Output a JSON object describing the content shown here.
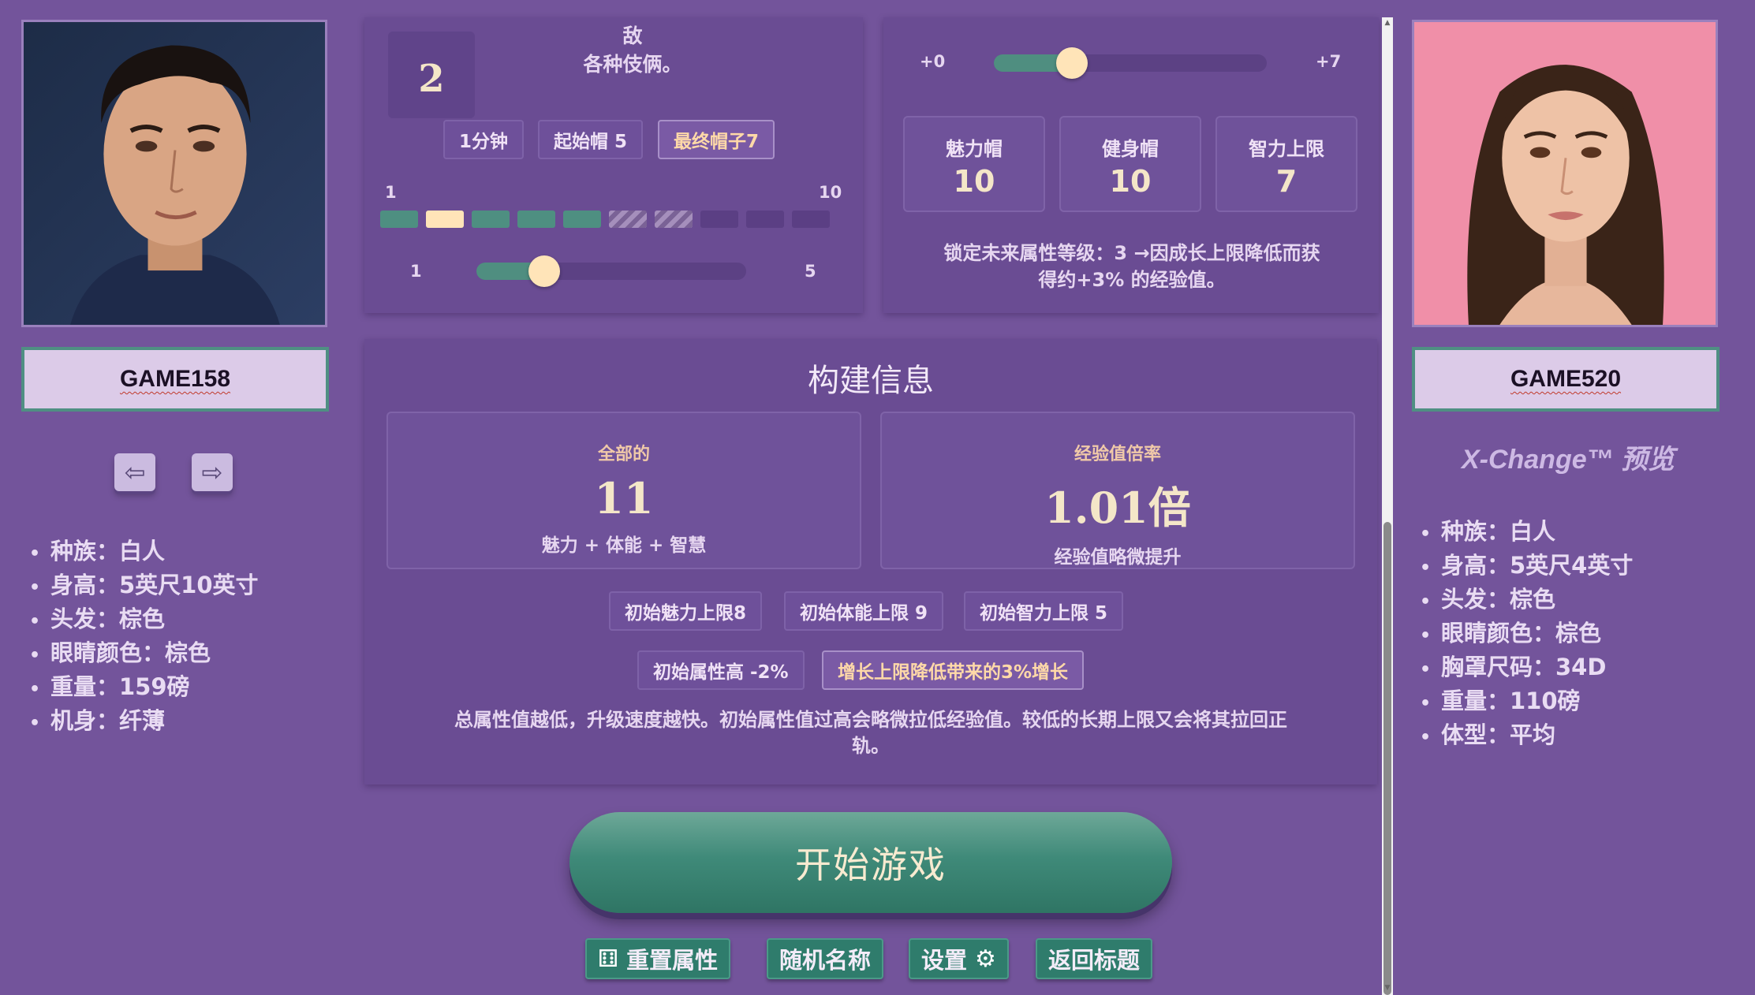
{
  "left_profile": {
    "username": "GAME158",
    "traits": [
      "种族：白人",
      "身高：5英尺10英寸",
      "头发：棕色",
      "眼睛颜色：棕色",
      "重量：159磅",
      "机身：纤薄"
    ]
  },
  "right_profile": {
    "username": "GAME520",
    "preview_title": "X-Change™ 预览",
    "traits": [
      "种族：白人",
      "身高：5英尺4英寸",
      "头发：棕色",
      "眼睛颜色：棕色",
      "胸罩尺码：34D",
      "重量：110磅",
      "体型：平均"
    ]
  },
  "panel_a": {
    "big_number": "2",
    "cut_text_line1": "提升你的就业前景，并帮助你职敌",
    "cut_text_line2": "各种伎俩。",
    "chips": [
      "1分钟",
      "起始帽 5",
      "最终帽子7"
    ],
    "active_chip": "最终帽子7",
    "range_min": "1",
    "range_max": "10",
    "segments": [
      "teal",
      "cream",
      "teal",
      "teal",
      "teal",
      "hatch",
      "hatch",
      "dark",
      "dark",
      "dark"
    ],
    "slider": {
      "min_label": "1",
      "max_label": "5",
      "value": 2,
      "min": 1,
      "max": 5
    }
  },
  "panel_b": {
    "slider": {
      "min_label": "+0",
      "max_label": "+7",
      "value": 2,
      "min": 0,
      "max": 7
    },
    "stats": [
      {
        "label": "魅力帽",
        "value": "10"
      },
      {
        "label": "健身帽",
        "value": "10"
      },
      {
        "label": "智力上限",
        "value": "7"
      }
    ],
    "lock_note_line1": "锁定未来属性等级：3 →因成长上限降低而获",
    "lock_note_line2": "得约+3% 的经验值。"
  },
  "build_info": {
    "title": "构建信息",
    "total": {
      "label": "全部的",
      "value": "11",
      "sub": "魅力 + 体能 + 智慧"
    },
    "exp": {
      "label": "经验值倍率",
      "value": "1.01倍",
      "sub": "经验值略微提升"
    },
    "caps": [
      "初始魅力上限8",
      "初始体能上限 9",
      "初始智力上限 5"
    ],
    "mods": [
      "初始属性高 -2%",
      "增长上限降低带来的3%增长"
    ],
    "note_line1": "总属性值越低，升级速度越快。初始属性值过高会略微拉低经验值。较低的长期上限又会将其拉回正",
    "note_line2": "轨。"
  },
  "actions": {
    "start": "开始游戏",
    "reset": "重置属性",
    "random_name": "随机名称",
    "settings": "设置",
    "back": "返回标题"
  },
  "colors": {
    "background": "#73549b",
    "panel": "#6a4c93",
    "teal": "#4f8e80",
    "cream": "#ffe4b8"
  }
}
